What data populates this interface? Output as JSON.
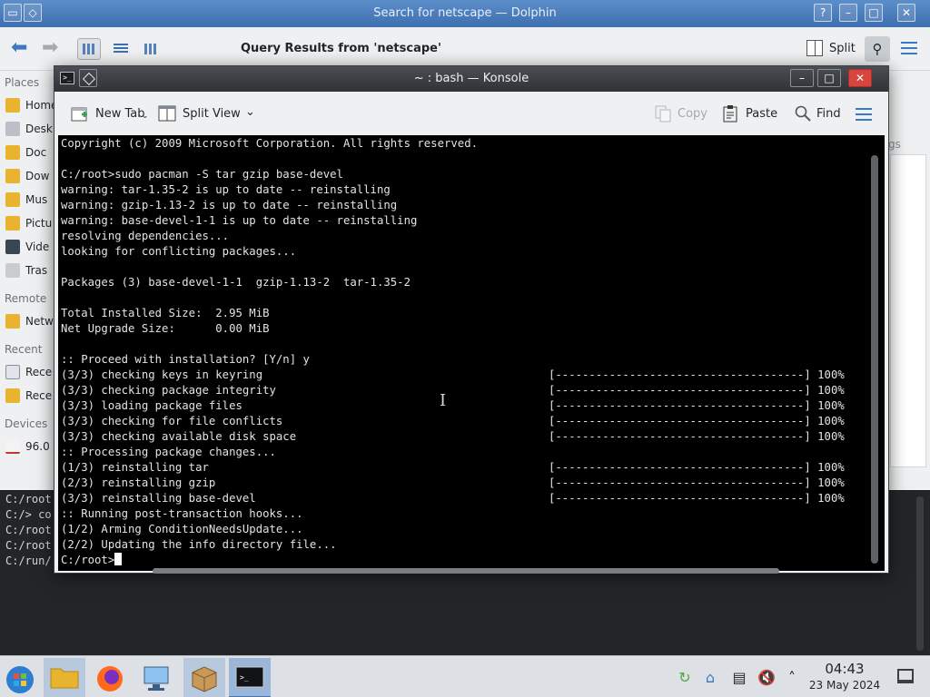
{
  "dolphin": {
    "title": "Search for netscape — Dolphin",
    "query_heading": "Query Results from 'netscape'",
    "split_label": "Split",
    "tags_label": "gs",
    "places": {
      "section_places": "Places",
      "section_remote": "Remote",
      "section_recent": "Recent",
      "section_devices": "Devices",
      "items": [
        "Home",
        "Desk",
        "Doc",
        "Dow",
        "Mus",
        "Pictu",
        "Vide",
        "Tras",
        "Netw",
        "Rece",
        "Rece",
        "96.0"
      ]
    },
    "terminal_lines": [
      "C:/root",
      "C:/> co",
      "C:/root",
      "C:/root",
      "C:/run/"
    ]
  },
  "konsole": {
    "title": "~ : bash — Konsole",
    "toolbar": {
      "new_tab": "New Tab",
      "split_view": "Split View",
      "copy": "Copy",
      "paste": "Paste",
      "find": "Find"
    },
    "lines": [
      "Copyright (c) 2009 Microsoft Corporation. All rights reserved.",
      "",
      "C:/root>sudo pacman -S tar gzip base-devel",
      "warning: tar-1.35-2 is up to date -- reinstalling",
      "warning: gzip-1.13-2 is up to date -- reinstalling",
      "warning: base-devel-1-1 is up to date -- reinstalling",
      "resolving dependencies...",
      "looking for conflicting packages...",
      "",
      "Packages (3) base-devel-1-1  gzip-1.13-2  tar-1.35-2",
      "",
      "Total Installed Size:  2.95 MiB",
      "Net Upgrade Size:      0.00 MiB",
      "",
      ":: Proceed with installation? [Y/n] y",
      "(3/3) checking keys in keyring",
      "(3/3) checking package integrity",
      "(3/3) loading package files",
      "(3/3) checking for file conflicts",
      "(3/3) checking available disk space",
      ":: Processing package changes...",
      "(1/3) reinstalling tar",
      "(2/3) reinstalling gzip",
      "(3/3) reinstalling base-devel",
      ":: Running post-transaction hooks...",
      "(1/2) Arming ConditionNeedsUpdate...",
      "(2/2) Updating the info directory file..."
    ],
    "progress_bar": "[-------------------------------------] 100%",
    "prompt": "C:/root>"
  },
  "taskbar": {
    "time": "04:43",
    "date": "23 May 2024"
  },
  "colors": {
    "accent": "#3d78c2",
    "terminal_bg": "#000000",
    "close_red": "#d8453f"
  }
}
